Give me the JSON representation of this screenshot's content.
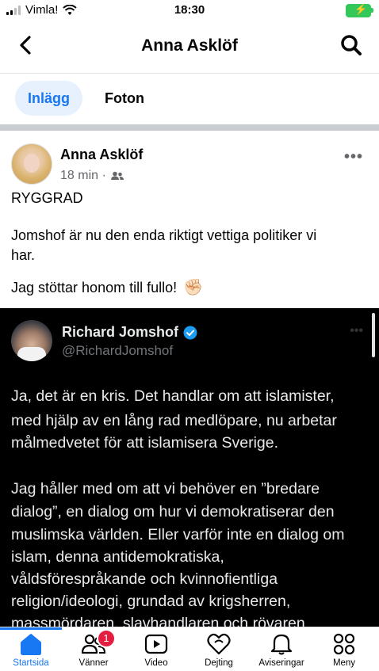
{
  "status": {
    "carrier": "Vimla!",
    "time": "18:30"
  },
  "header": {
    "title": "Anna Asklöf"
  },
  "tabs": [
    {
      "label": "Inlägg"
    },
    {
      "label": "Foton"
    }
  ],
  "post": {
    "author": "Anna Asklöf",
    "time": "18 min ·",
    "text": {
      "line1": "RYGGRAD",
      "line2": "Jomshof är nu den enda riktigt vettiga politiker vi",
      "line3": "har.",
      "line4": "Jag stöttar honom till fullo!"
    }
  },
  "tweet": {
    "name": "Richard Jomshof",
    "handle": "@RichardJomshof",
    "lines": [
      "Ja, det är en kris. Det handlar om att islamister,",
      "med hjälp av en lång rad  medlöpare, nu arbetar",
      "målmedvetet för att islamisera Sverige.",
      "Jag håller med om att vi behöver en ”bredare",
      "dialog”, en dialog om hur vi demokratiserar den",
      "muslimska världen. Eller varför inte en dialog om",
      "islam, denna antidemokratiska,",
      "våldsförespråkande och kvinnofientliga",
      "religion/ideologi, grundad av krigsherren,",
      "massmördaren, slavhandlaren och rövaren"
    ]
  },
  "tabbar": {
    "items": [
      {
        "label": "Startsida"
      },
      {
        "label": "Vänner",
        "badge": "1"
      },
      {
        "label": "Video"
      },
      {
        "label": "Dejting"
      },
      {
        "label": "Aviseringar"
      },
      {
        "label": "Meny"
      }
    ]
  },
  "colors": {
    "accent": "#1877f2",
    "badge": "#e41e3f",
    "verified": "#1d9bf0"
  }
}
